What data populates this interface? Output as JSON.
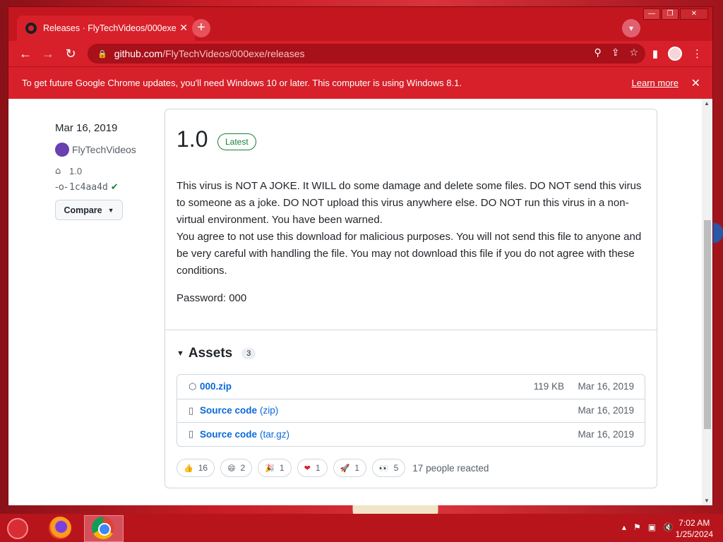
{
  "browser": {
    "tab_title": "Releases · FlyTechVideos/000exe",
    "tab_close": "✕",
    "new_tab": "+",
    "url_domain": "github.com",
    "url_path": "/FlyTechVideos/000exe/releases",
    "infobar_text": "To get future Google Chrome updates, you'll need Windows 10 or later. This computer is using Windows 8.1.",
    "infobar_link": "Learn more",
    "infobar_close": "✕"
  },
  "release": {
    "date": "Mar 16, 2019",
    "author": "FlyTechVideos",
    "tag": "1.0",
    "commit": "1c4aa4d",
    "compare_label": "Compare",
    "version": "1.0",
    "latest_badge": "Latest",
    "body": "This virus is NOT A JOKE. It WILL do some damage and delete some files. DO NOT send this virus to someone as a joke. DO NOT upload this virus anywhere else. DO NOT run this virus in a non-virtual environment. You have been warned.\nYou agree to not use this download for malicious purposes. You will not send this file to anyone and be very careful with handling the file. You may not download this file if you do not agree with these conditions.",
    "password": "Password: 000"
  },
  "assets": {
    "title": "Assets",
    "count": "3",
    "items": [
      {
        "name": "000.zip",
        "ext": "",
        "size": "119 KB",
        "date": "Mar 16, 2019",
        "icon": "package-icon"
      },
      {
        "name": "Source code",
        "ext": "(zip)",
        "size": "",
        "date": "Mar 16, 2019",
        "icon": "file-zip-icon"
      },
      {
        "name": "Source code",
        "ext": "(tar.gz)",
        "size": "",
        "date": "Mar 16, 2019",
        "icon": "file-zip-icon"
      }
    ]
  },
  "reactions": {
    "items": [
      {
        "emoji": "👍",
        "count": "16",
        "icon": "thumbs-up-icon"
      },
      {
        "emoji": "😄",
        "count": "2",
        "icon": "laugh-icon"
      },
      {
        "emoji": "🎉",
        "count": "1",
        "icon": "hooray-icon"
      },
      {
        "emoji": "❤",
        "count": "1",
        "icon": "heart-icon"
      },
      {
        "emoji": "🚀",
        "count": "1",
        "icon": "rocket-icon"
      },
      {
        "emoji": "👀",
        "count": "5",
        "icon": "eyes-icon"
      }
    ],
    "summary": "17 people reacted"
  },
  "taskbar": {
    "time": "7:02 AM",
    "date": "1/25/2024"
  },
  "colors": {
    "accent": "#d8202a",
    "link": "#0969da",
    "success": "#1a7f37"
  }
}
